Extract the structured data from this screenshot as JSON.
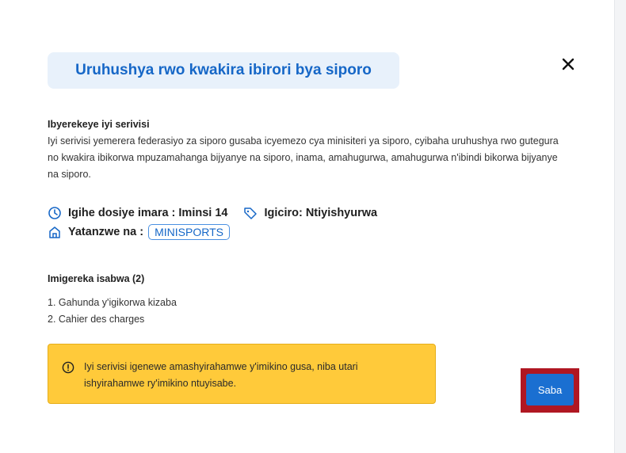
{
  "modal": {
    "title": "Uruhushya rwo kwakira ibirori bya siporo",
    "close_icon": "close-icon"
  },
  "about": {
    "heading": "Ibyerekeye iyi serivisi",
    "description": "Iyi serivisi yemerera federasiyo za siporo gusaba icyemezo cya minisiteri ya siporo, cyibaha uruhushya rwo gutegura no kwakira ibikorwa mpuzamahanga bijyanye na siporo, inama, amahugurwa, amahugurwa n'ibindi bikorwa bijyanye na siporo."
  },
  "meta": {
    "duration": "Igihe dosiye imara : Iminsi 14",
    "price": "Igiciro: Ntiyishyurwa",
    "issued_by_label": "Yatanzwe na :",
    "issued_by_value": "MINISPORTS",
    "icons": [
      "clock-icon",
      "tag-icon",
      "building-icon"
    ]
  },
  "documents": {
    "heading": "Imigereka isabwa (2)",
    "items": [
      "1. Gahunda y'igikorwa kizaba",
      "2. Cahier des charges"
    ]
  },
  "warning": {
    "text": "Iyi serivisi igenewe amashyirahamwe y'imikino gusa, niba utari ishyirahamwe ry'imikino ntuyisabe.",
    "icon": "info-circle-icon",
    "color": "#ffca3a"
  },
  "actions": {
    "apply_label": "Saba",
    "apply_color": "#1a6fd1",
    "highlight_color": "#b01722"
  },
  "colors": {
    "accent": "#1667c7",
    "title_bg": "#e8f1fb"
  }
}
